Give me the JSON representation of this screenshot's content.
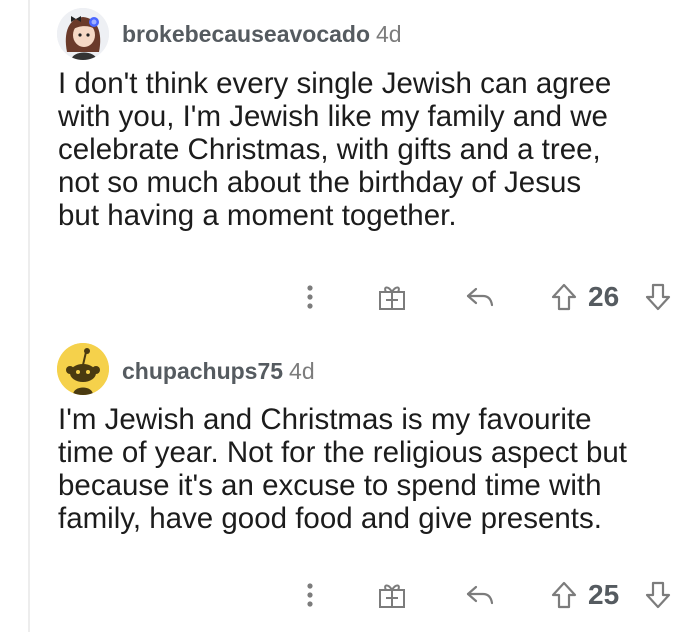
{
  "comments": [
    {
      "username": "brokebecauseavocado",
      "age": "4d",
      "text": "I don't think every single Jewish can agree\nwith you, I'm Jewish like my family and we\ncelebrate Christmas, with gifts and a tree,\nnot so much about the birthday of Jesus\nbut having a moment together.",
      "score": "26",
      "avatar": "girl-avatar-icon"
    },
    {
      "username": "chupachups75",
      "age": "4d",
      "text": "I'm Jewish and Christmas is my favourite\ntime of year. Not for the religious aspect but\nbecause it's an excuse to spend time with\nfamily, have good food and give presents.",
      "score": "25",
      "avatar": "snoo-avatar-icon"
    }
  ],
  "colors": {
    "text": "#1c1c1c",
    "meta": "#555b60",
    "age": "#7c7c7c",
    "thread_line": "#ededed",
    "avatar2_bg": "#f5d14b"
  }
}
